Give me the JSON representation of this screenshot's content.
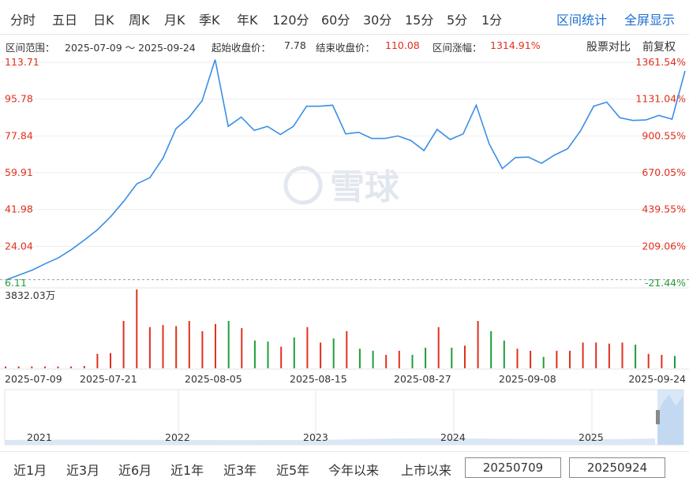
{
  "top_tabs": [
    "分时",
    "五日",
    "日K",
    "周K",
    "月K",
    "季K",
    "年K",
    "120分",
    "60分",
    "30分",
    "15分",
    "5分",
    "1分"
  ],
  "top_actions": {
    "interval_stats": "区间统计",
    "fullscreen": "全屏显示"
  },
  "info": {
    "range_label": "区间范围：",
    "range_value": "2025-07-09 ～ 2025-09-24",
    "start_label": "起始收盘价：",
    "start_value": "7.78",
    "end_label": "结束收盘价：",
    "end_value": "110.08",
    "change_label": "区间涨幅：",
    "change_value": "1314.91%",
    "compare_link": "股票对比",
    "adjust_link": "前复权"
  },
  "watermark": "雪球",
  "volume_max_label": "3832.03万",
  "colors": {
    "line": "#3a8ee6",
    "up": "#e0301e",
    "down": "#1f9d3a",
    "accent": "#1e6fd4"
  },
  "chart_data": [
    {
      "type": "line",
      "title": "",
      "ylim": [
        6.11,
        113.71
      ],
      "y_ticks": [
        "113.71",
        "95.78",
        "77.84",
        "59.91",
        "41.98",
        "24.04",
        "6.11"
      ],
      "y_right_ticks": [
        "1361.54%",
        "1131.04%",
        "900.55%",
        "670.05%",
        "439.55%",
        "209.06%",
        "-21.44%"
      ],
      "x_ticks": [
        "2025-07-09",
        "2025-07-21",
        "2025-08-05",
        "2025-08-15",
        "2025-08-27",
        "2025-09-08",
        "2025-09-24"
      ],
      "grid": true,
      "series": [
        {
          "values": [
            7.78,
            10.1,
            12.5,
            15.6,
            18.5,
            22.5,
            27.2,
            32.2,
            38.5,
            46.0,
            54.5,
            57.5,
            67.0,
            81.4,
            86.9,
            95.0,
            115.0,
            82.5,
            87.0,
            80.5,
            82.5,
            78.5,
            82.5,
            92.3,
            92.3,
            92.8,
            78.8,
            79.6,
            76.6,
            76.6,
            77.8,
            75.6,
            70.7,
            81.0,
            76.1,
            78.8,
            92.8,
            73.9,
            61.9,
            67.3,
            67.5,
            64.5,
            68.5,
            71.6,
            80.4,
            92.3,
            94.3,
            86.7,
            85.4,
            85.6,
            87.8,
            86.0,
            109.5
          ]
        }
      ]
    },
    {
      "type": "bar",
      "title": "",
      "ylim": [
        0,
        3832.03
      ],
      "series": [
        {
          "values": [
            90,
            90,
            90,
            90,
            90,
            90,
            110,
            700,
            740,
            2300,
            3832,
            2000,
            2100,
            2050,
            2300,
            1800,
            2150,
            2300,
            1950,
            1350,
            1300,
            1050,
            1500,
            2000,
            1250,
            1450,
            1800,
            950,
            850,
            650,
            850,
            650,
            1000,
            2000,
            1000,
            1100,
            2300,
            1800,
            1350,
            950,
            850,
            550,
            850,
            850,
            1250,
            1250,
            1200,
            1250,
            1150,
            700,
            650,
            600
          ],
          "direction": [
            "up",
            "up",
            "up",
            "up",
            "up",
            "up",
            "up",
            "up",
            "up",
            "up",
            "up",
            "up",
            "up",
            "up",
            "up",
            "up",
            "up",
            "down",
            "up",
            "down",
            "down",
            "up",
            "down",
            "up",
            "up",
            "down",
            "up",
            "down",
            "down",
            "up",
            "up",
            "down",
            "down",
            "up",
            "down",
            "up",
            "up",
            "down",
            "down",
            "up",
            "up",
            "down",
            "up",
            "up",
            "up",
            "up",
            "up",
            "up",
            "down",
            "up",
            "up",
            "down"
          ]
        }
      ]
    }
  ],
  "navigator": {
    "years": [
      "2021",
      "2022",
      "2023",
      "2024",
      "2025"
    ]
  },
  "bottom": {
    "ranges": [
      "近1月",
      "近3月",
      "近6月",
      "近1年",
      "近3年",
      "近5年",
      "今年以来",
      "上市以来"
    ],
    "start_date": "20250709",
    "end_date": "20250924"
  }
}
